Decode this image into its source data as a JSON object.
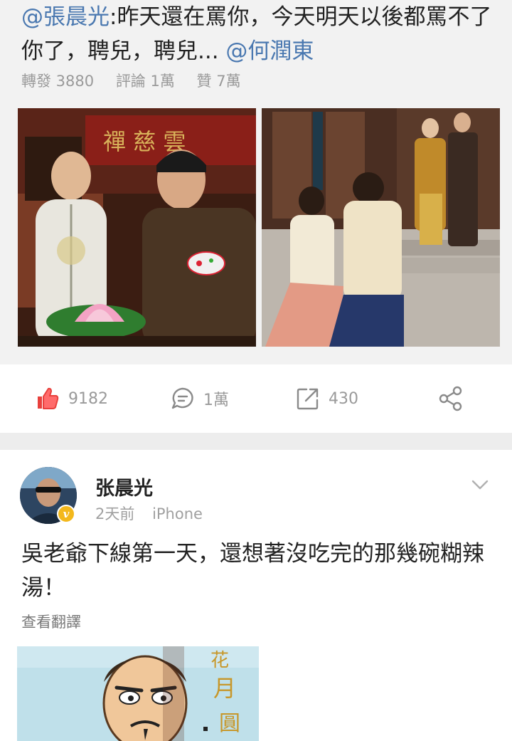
{
  "repost": {
    "mention_author": "@張晨光",
    "text": ":昨天還在罵你，今天明天以後都罵不了你了，聘兒，聘兒... ",
    "mention_end": "@何潤東",
    "stats": {
      "reposts": "轉發 3880",
      "comments": "評論 1萬",
      "likes": "贊 7萬"
    }
  },
  "actions": {
    "like_count": "9182",
    "comment_count": "1萬",
    "repost_count": "430"
  },
  "post": {
    "author": "张晨光",
    "time": "2天前",
    "source": "iPhone",
    "verify_badge": "v",
    "text": "吳老爺下線第一天，還想著沒吃完的那幾碗糊辣湯！",
    "translate_link": "查看翻譯"
  },
  "icons": {
    "like": "thumbs-up-icon",
    "comment": "comment-bubble-icon",
    "repost": "repost-arrow-icon",
    "share": "share-icon",
    "chevron": "chevron-down-icon"
  },
  "colors": {
    "mention": "#4a78b0",
    "like_red": "#e8403c",
    "verify_gold": "#f3b81c"
  }
}
